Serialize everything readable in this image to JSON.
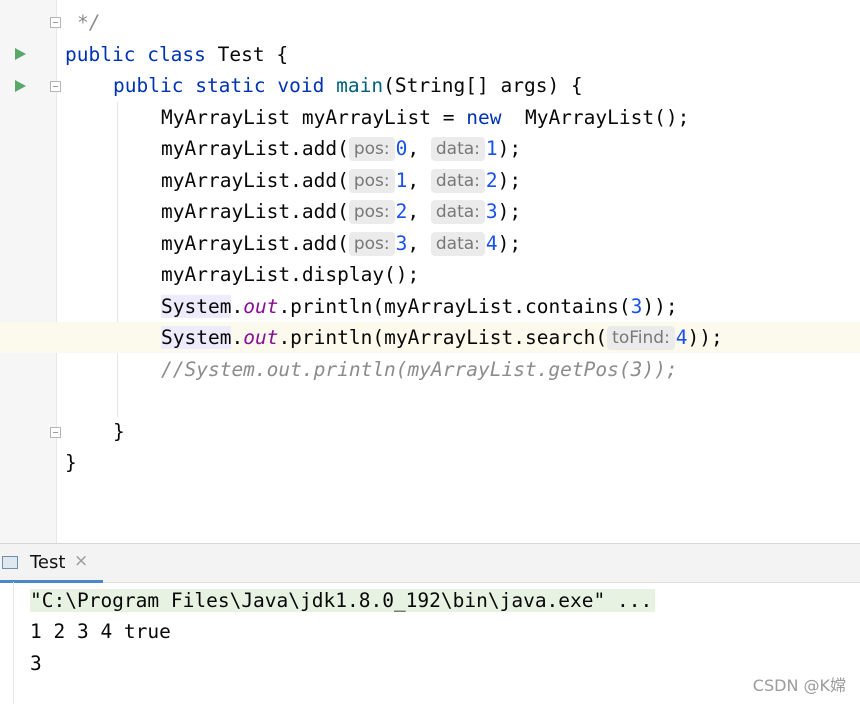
{
  "editor": {
    "lines": {
      "l0": "*/",
      "l1_kw1": "public",
      "l1_kw2": "class",
      "l1_rest": " Test {",
      "l2_kw1": "public",
      "l2_kw2": "static",
      "l2_kw3": "void",
      "l2_method": "main",
      "l2_rest": "(String[] args) {",
      "l3_a": "MyArrayList myArrayList = ",
      "l3_kw": "new",
      "l3_b": "  MyArrayList();",
      "add_call": "myArrayList.add(",
      "comma": ",",
      "close": ");",
      "display": "myArrayList.display();",
      "system": "System",
      "dot": ".",
      "out": "out",
      "contains_pre": ".println(myArrayList.contains(",
      "contains_arg": "3",
      "contains_post": "));",
      "search_pre": ".println(myArrayList.search(",
      "search_arg": "4",
      "search_post": "));",
      "comment": "//System.out.println(myArrayList.getPos(3));",
      "brace_inner": "}",
      "brace_outer": "}"
    },
    "hints": {
      "pos": "pos:",
      "data": "data:",
      "toFind": "toFind:"
    },
    "add_args": [
      {
        "pos": "0",
        "data": "1"
      },
      {
        "pos": "1",
        "data": "2"
      },
      {
        "pos": "2",
        "data": "3"
      },
      {
        "pos": "3",
        "data": "4"
      }
    ]
  },
  "run_panel": {
    "tab_label": "Test",
    "tab_close": "×",
    "console": {
      "cmd": "\"C:\\Program Files\\Java\\jdk1.8.0_192\\bin\\java.exe\" ...",
      "out1": "1 2 3 4 true",
      "out2": "3"
    }
  },
  "watermark": "CSDN @K嫦",
  "colors": {
    "keyword": "#0033b3",
    "number": "#1750eb",
    "static_field": "#871094",
    "comment": "#8c8c8c",
    "run_icon": "#59a869",
    "current_line": "#fcfaed",
    "tab_underline": "#4a88c7"
  },
  "icons": [
    "run-gutter-icon",
    "fold-icon",
    "console-tab-icon",
    "close-icon"
  ]
}
